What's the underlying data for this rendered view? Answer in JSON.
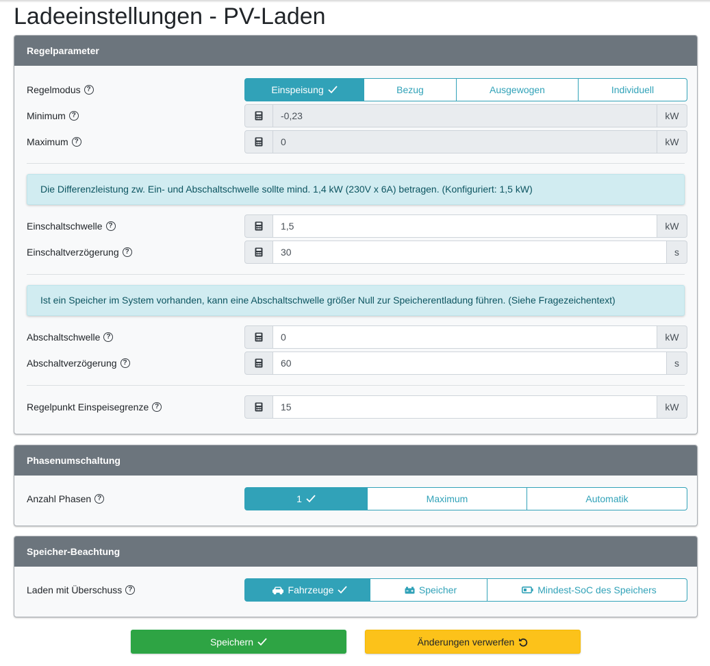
{
  "page": {
    "title": "Ladeeinstellungen - PV-Laden"
  },
  "regelparameter": {
    "header": "Regelparameter",
    "regelmodus": {
      "label": "Regelmodus",
      "options": [
        "Einspeisung",
        "Bezug",
        "Ausgewogen",
        "Individuell"
      ],
      "selected": "Einspeisung"
    },
    "minimum": {
      "label": "Minimum",
      "value": "-0,23",
      "unit": "kW",
      "disabled": true
    },
    "maximum": {
      "label": "Maximum",
      "value": "0",
      "unit": "kW",
      "disabled": true
    },
    "alert_diff": "Die Differenzleistung zw. Ein- und Abschaltschwelle sollte mind. 1,4 kW (230V x 6A) betragen. (Konfiguriert: 1,5 kW)",
    "einschaltschwelle": {
      "label": "Einschaltschwelle",
      "value": "1,5",
      "unit": "kW"
    },
    "einschaltverzoegerung": {
      "label": "Einschaltverzögerung",
      "value": "30",
      "unit": "s"
    },
    "alert_speicher": "Ist ein Speicher im System vorhanden, kann eine Abschaltschwelle größer Null zur Speicherentladung führen. (Siehe Fragezeichentext)",
    "abschaltschwelle": {
      "label": "Abschaltschwelle",
      "value": "0",
      "unit": "kW"
    },
    "abschaltverzoegerung": {
      "label": "Abschaltverzögerung",
      "value": "60",
      "unit": "s"
    },
    "regelpunkt": {
      "label": "Regelpunkt Einspeisegrenze",
      "value": "15",
      "unit": "kW"
    }
  },
  "phasen": {
    "header": "Phasenumschaltung",
    "anzahl": {
      "label": "Anzahl Phasen",
      "options": [
        "1",
        "Maximum",
        "Automatik"
      ],
      "selected": "1"
    }
  },
  "speicher": {
    "header": "Speicher-Beachtung",
    "laden": {
      "label": "Laden mit Überschuss",
      "options": [
        "Fahrzeuge",
        "Speicher",
        "Mindest-SoC des Speichers"
      ],
      "icons": [
        "car-icon",
        "battery-car-icon",
        "battery-icon"
      ],
      "selected": "Fahrzeuge"
    }
  },
  "buttons": {
    "save": "Speichern",
    "discard": "Änderungen verwerfen"
  },
  "colors": {
    "accent": "#31a2b8",
    "header": "#6c757d",
    "save": "#2ea444",
    "discard": "#fcc21a",
    "alert_bg": "#d1ecf1"
  }
}
